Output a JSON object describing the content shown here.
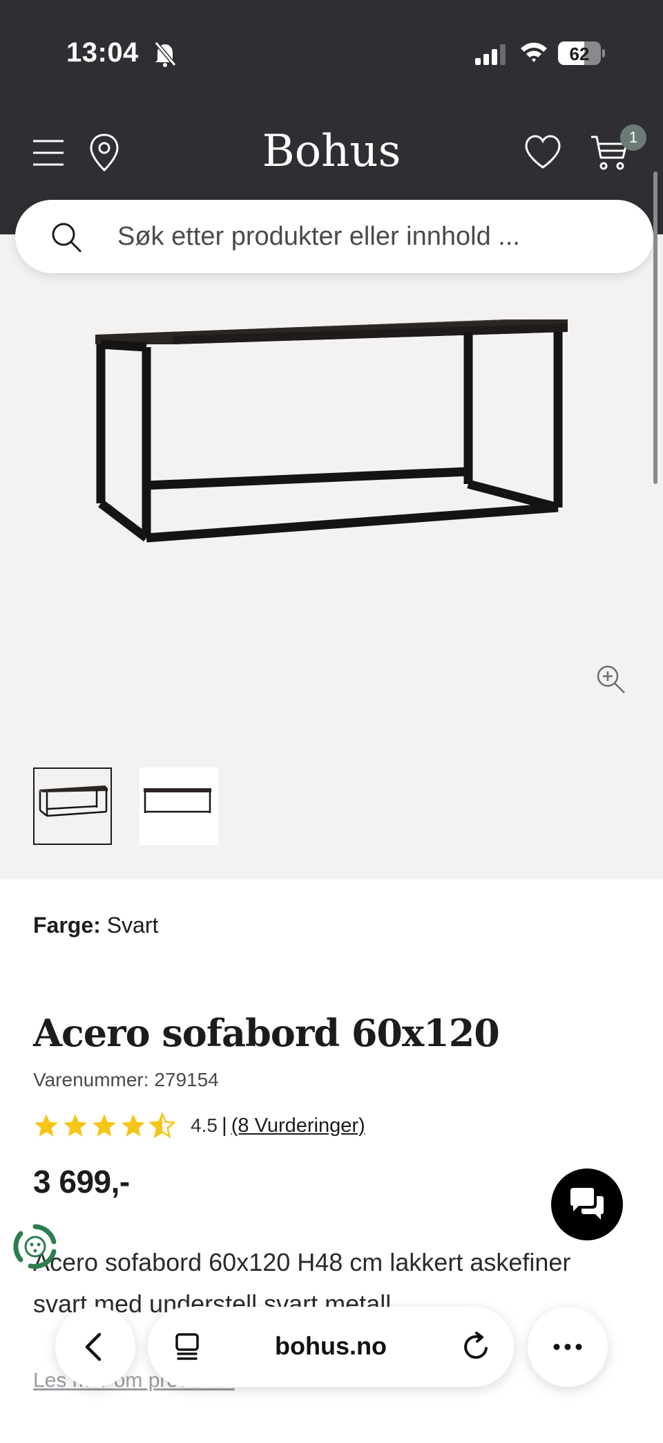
{
  "status_bar": {
    "time": "13:04",
    "battery": "62",
    "battery_level": 0.62
  },
  "header": {
    "logo": "Bohus",
    "cart_count": "1"
  },
  "search": {
    "placeholder": "Søk etter produkter eller innhold ..."
  },
  "product": {
    "color_label": "Farge:",
    "color_value": "Svart",
    "title": "Acero sofabord 60x120",
    "sku": "Varenummer: 279154",
    "rating_value": "4.5",
    "rating_separator": "|",
    "rating_stars": 4.5,
    "reviews_link": "(8 Vurderinger)",
    "price": "3 699,-",
    "description": "Acero sofabord 60x120 H48 cm lakkert askefiner svart med understell svart metall",
    "read_more": "Les mer om produktet"
  },
  "browser": {
    "url": "bohus.no"
  },
  "icons": [
    "bell-slash-icon",
    "signal-icon",
    "wifi-icon",
    "battery-icon",
    "menu-icon",
    "location-pin-icon",
    "heart-icon",
    "cart-icon",
    "search-icon",
    "zoom-in-icon",
    "star-icon",
    "half-star-icon",
    "chat-icon",
    "eco-badge-icon",
    "back-arrow-icon",
    "tabs-icon",
    "reload-icon",
    "more-icon"
  ],
  "colors": {
    "header_bg": "#2f2f33",
    "gallery_bg": "#f4f2f0",
    "star": "#f5c518",
    "badge": "#6d7b78",
    "eco_green": "#2e7d4f"
  }
}
